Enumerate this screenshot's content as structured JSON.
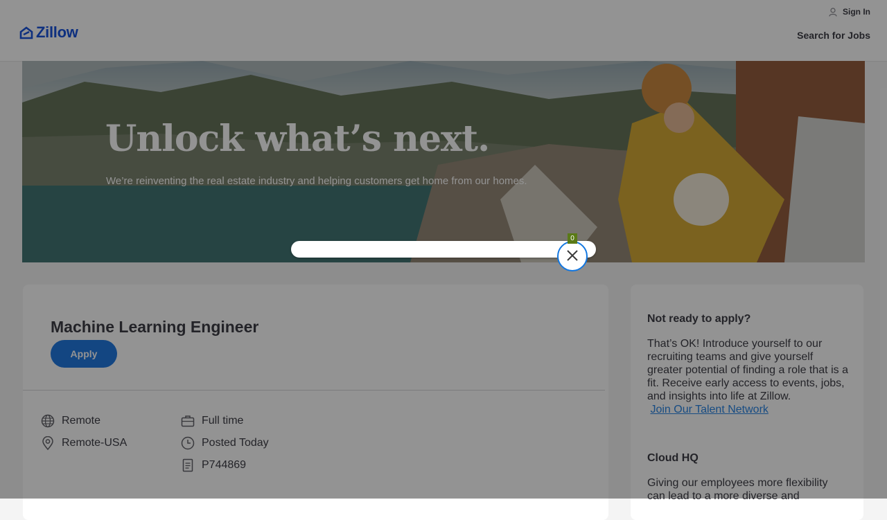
{
  "header": {
    "brand": "Zillow",
    "sign_in": "Sign In",
    "search_jobs": "Search for Jobs"
  },
  "hero": {
    "title": "Unlock what’s next.",
    "subtitle": "We’re reinventing the real estate industry and helping customers get home from our homes."
  },
  "overlay_widget": {
    "count": "0"
  },
  "job": {
    "title": "Machine Learning Engineer",
    "apply_label": "Apply",
    "details": {
      "workplace": "Remote",
      "location": "Remote-USA",
      "type": "Full time",
      "posted": "Posted Today",
      "req_id": "P744869"
    }
  },
  "sidebar": {
    "section1_title": "Not ready to apply?",
    "section1_body": "That’s OK! Introduce yourself to our recruiting teams and give yourself greater potential of finding a role that is a fit. Receive early access to events, jobs, and insights into life at Zillow.",
    "section1_link": "Join Our Talent Network",
    "section2_title": "Cloud HQ",
    "section2_body": "Giving our employees more flexibility can lead to a more diverse and"
  },
  "colors": {
    "brand_blue": "#0041d9",
    "apply_blue": "#0b6cdf",
    "link_blue": "#1277e1"
  }
}
